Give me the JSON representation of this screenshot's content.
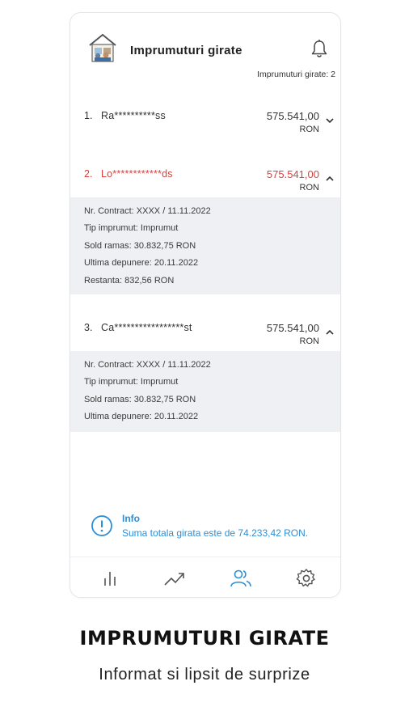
{
  "header": {
    "title": "Imprumuturi girate",
    "count_text": "Imprumuturi girate: 2"
  },
  "loans": [
    {
      "number": "1.",
      "name": "Ra**********ss",
      "amount": "575.541,00",
      "currency": "RON",
      "expanded": false,
      "overdue": false
    },
    {
      "number": "2.",
      "name": "Lo************ds",
      "amount": "575.541,00",
      "currency": "RON",
      "expanded": true,
      "overdue": true,
      "details": {
        "contract": "Nr. Contract: XXXX / 11.11.2022",
        "type": "Tip imprumut: Imprumut",
        "balance": "Sold ramas: 30.832,75 RON",
        "last_deposit": "Ultima depunere: 20.11.2022",
        "arrears": "Restanta: 832,56 RON"
      }
    },
    {
      "number": "3.",
      "name": "Ca*****************st",
      "amount": "575.541,00",
      "currency": "RON",
      "expanded": true,
      "overdue": false,
      "details": {
        "contract": "Nr. Contract: XXXX / 11.11.2022",
        "type": "Tip imprumut: Imprumut",
        "balance": "Sold ramas: 30.832,75 RON",
        "last_deposit": "Ultima depunere: 20.11.2022"
      }
    }
  ],
  "info": {
    "title": "Info",
    "text": "Suma totala girata este de 74.233,42 RON."
  },
  "nav": {
    "items": [
      "chart-icon",
      "trend-icon",
      "users-icon",
      "settings-icon"
    ],
    "active": "users-icon"
  },
  "colors": {
    "accent": "#2b8fd8",
    "overdue": "#d9413c",
    "details_bg": "#eef0f4"
  },
  "caption": {
    "title": "IMPRUMUTURI GIRATE",
    "subtitle": "Informat si lipsit de surprize"
  }
}
